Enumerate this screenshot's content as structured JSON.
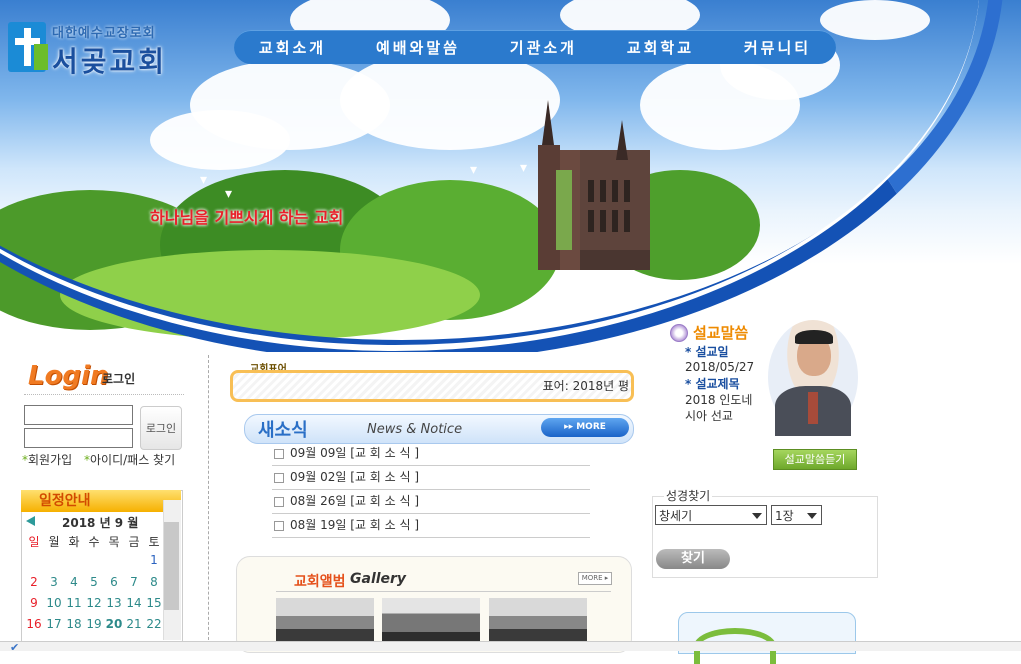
{
  "logo": {
    "subtitle": "대한예수교장로회",
    "name": "서곶교회"
  },
  "nav": [
    "교회소개",
    "예배와말씀",
    "기관소개",
    "교회학교",
    "커뮤니티"
  ],
  "banner": {
    "tagline": "하나님을 기쁘시게 하는 교회",
    "church_sign": "서곶교회"
  },
  "login": {
    "title": "Login",
    "subtitle": "로그인",
    "button": "로그인",
    "links": [
      "회원가입",
      "아이디/패스 찾기"
    ]
  },
  "calendar": {
    "header": "일정안내",
    "title": "2018 년 9 월",
    "weekdays": [
      "일",
      "월",
      "화",
      "수",
      "목",
      "금",
      "토"
    ],
    "rows": [
      [
        "",
        "",
        "",
        "",
        "",
        "",
        "1"
      ],
      [
        "2",
        "3",
        "4",
        "5",
        "6",
        "7",
        "8"
      ],
      [
        "9",
        "10",
        "11",
        "12",
        "13",
        "14",
        "15"
      ],
      [
        "16",
        "17",
        "18",
        "19",
        "20",
        "21",
        "22"
      ]
    ]
  },
  "pyo": {
    "label": "교회표어",
    "text": "표어: 2018년 평"
  },
  "news": {
    "title": "새소식",
    "subtitle": "News & Notice",
    "more": "▸▸ MORE",
    "items": [
      {
        "date": "09월 09일",
        "title": "[교 회 소 식 ]"
      },
      {
        "date": "09월 02일",
        "title": "[교 회 소 식 ]"
      },
      {
        "date": "08월 26일",
        "title": "[교 회 소 식 ]"
      },
      {
        "date": "08월 19일",
        "title": "[교 회 소 식 ]"
      }
    ]
  },
  "album": {
    "title": "교회앨범",
    "title_en": "Gallery",
    "more": "MORE ▸"
  },
  "sermon": {
    "title": "설교말씀",
    "date_label": "* 설교일",
    "date": "2018/05/27",
    "subject_label": "* 설교제목",
    "subject_lines": [
      "2018 인도네",
      "시아 선교"
    ],
    "listen_button": "설교말씀듣기"
  },
  "bible": {
    "label": "성경찾기",
    "book": "창세기",
    "chapter": "1장",
    "search_button": "찾기"
  },
  "colors": {
    "nav": "#2b7acd",
    "brand_blue": "#1452b5",
    "accent_orange": "#f07a22",
    "sunday_red": "#e8202a"
  }
}
